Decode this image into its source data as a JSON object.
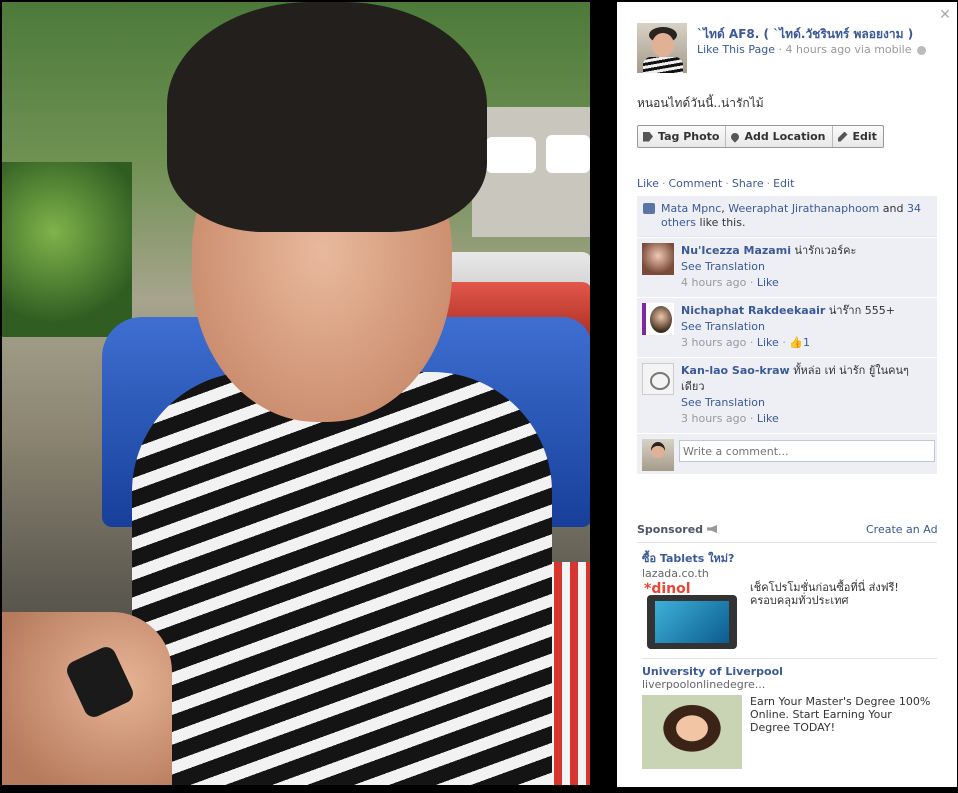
{
  "post": {
    "owner_name": "`ไทด์ AF8. ( `ไทด์.วัชรินทร์ พลอยงาม )",
    "like_page": "Like This Page",
    "time": "4 hours ago via mobile",
    "caption": "หนอนไทด์วันนี้..น่ารักไม้",
    "buttons": {
      "tag": "Tag Photo",
      "location": "Add Location",
      "edit": "Edit"
    },
    "actions": {
      "like": "Like",
      "comment": "Comment",
      "share": "Share",
      "edit": "Edit"
    }
  },
  "likes": {
    "name1": "Mata Mpnc",
    "name2": "Weeraphat Jirathanaphoom",
    "and": "and",
    "others": "34 others",
    "suffix": "like this."
  },
  "comments": [
    {
      "name": "Nu'Icezza Mazami",
      "text": "น่ารักเวอร์คะ",
      "translate": "See Translation",
      "time": "4 hours ago",
      "like": "Like"
    },
    {
      "name": "Nichaphat Rakdeekaair",
      "text": "น่าร๊าก 555+",
      "translate": "See Translation",
      "time": "3 hours ago",
      "like": "Like",
      "likes_count": "1"
    },
    {
      "name": "Kan-lao Sao-kraw",
      "text": "ทั้หล่อ เท่ น่ารัก ยู้ในคนๆเดียว",
      "translate": "See Translation",
      "time": "3 hours ago",
      "like": "Like"
    }
  ],
  "write_comment": {
    "placeholder": "Write a comment..."
  },
  "sponsored": {
    "label": "Sponsored",
    "create_ad": "Create an Ad",
    "ads": [
      {
        "title": "ซื้อ Tablets ใหม่?",
        "domain": "lazada.co.th",
        "logo": "*dinol",
        "body": "เช็คโปรโมชั่นก่อนซื้อที่นี่ ส่งฟรี! ครอบคลุมทั่วประเทศ"
      },
      {
        "title": "University of Liverpool",
        "domain": "liverpoolonlinedegre...",
        "body": "Earn Your Master's Degree 100% Online. Start Earning Your Degree TODAY!"
      }
    ]
  },
  "icons": {
    "close": "close-icon",
    "tag": "tag-icon",
    "location": "map-pin-icon",
    "edit": "pencil-icon",
    "globe": "globe-icon",
    "thumb": "thumbs-up-icon",
    "megaphone": "megaphone-icon"
  },
  "colors": {
    "link": "#3b5998",
    "ufi_bg": "#edeff4",
    "backdrop": "#000000"
  }
}
